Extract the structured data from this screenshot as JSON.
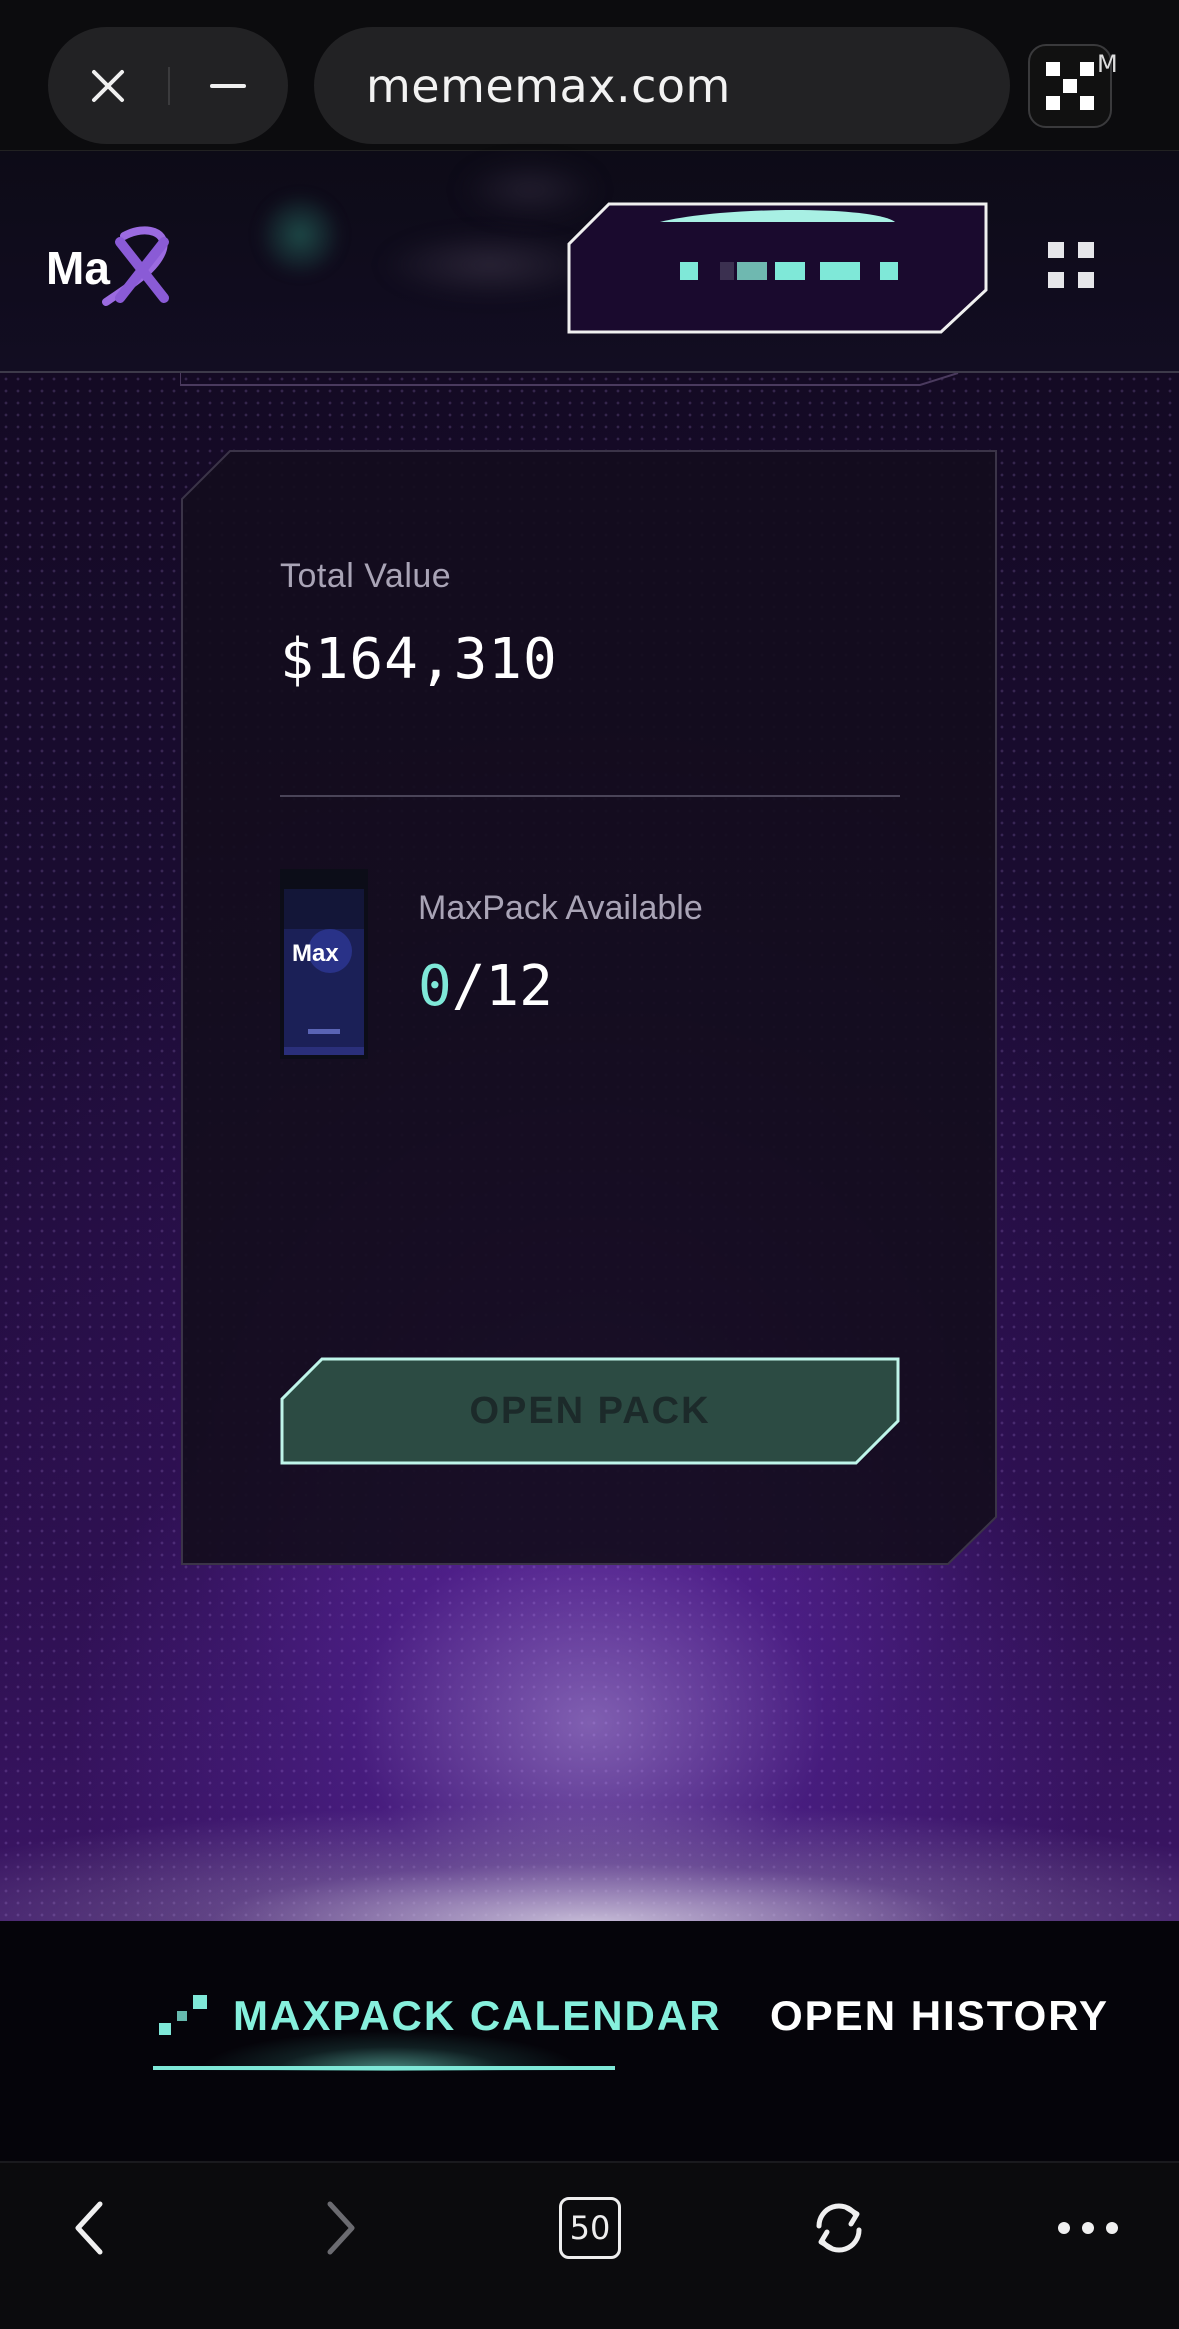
{
  "browser": {
    "url": "mememax.com",
    "extension_badge": "M",
    "tab_count": "50"
  },
  "header": {
    "logo_text": "Max"
  },
  "card": {
    "total_value_label": "Total Value",
    "total_value": "$164,310",
    "maxpack_label": "MaxPack Available",
    "maxpack_available": "0",
    "maxpack_total": "/12",
    "open_pack_label": "OPEN PACK"
  },
  "tabs": [
    {
      "label": "MAXPACK CALENDAR",
      "active": true
    },
    {
      "label": "OPEN HISTORY",
      "active": false
    }
  ],
  "colors": {
    "accent": "#7fe8d8",
    "button_fill": "#2c4b43",
    "card_bg": "#161020"
  }
}
